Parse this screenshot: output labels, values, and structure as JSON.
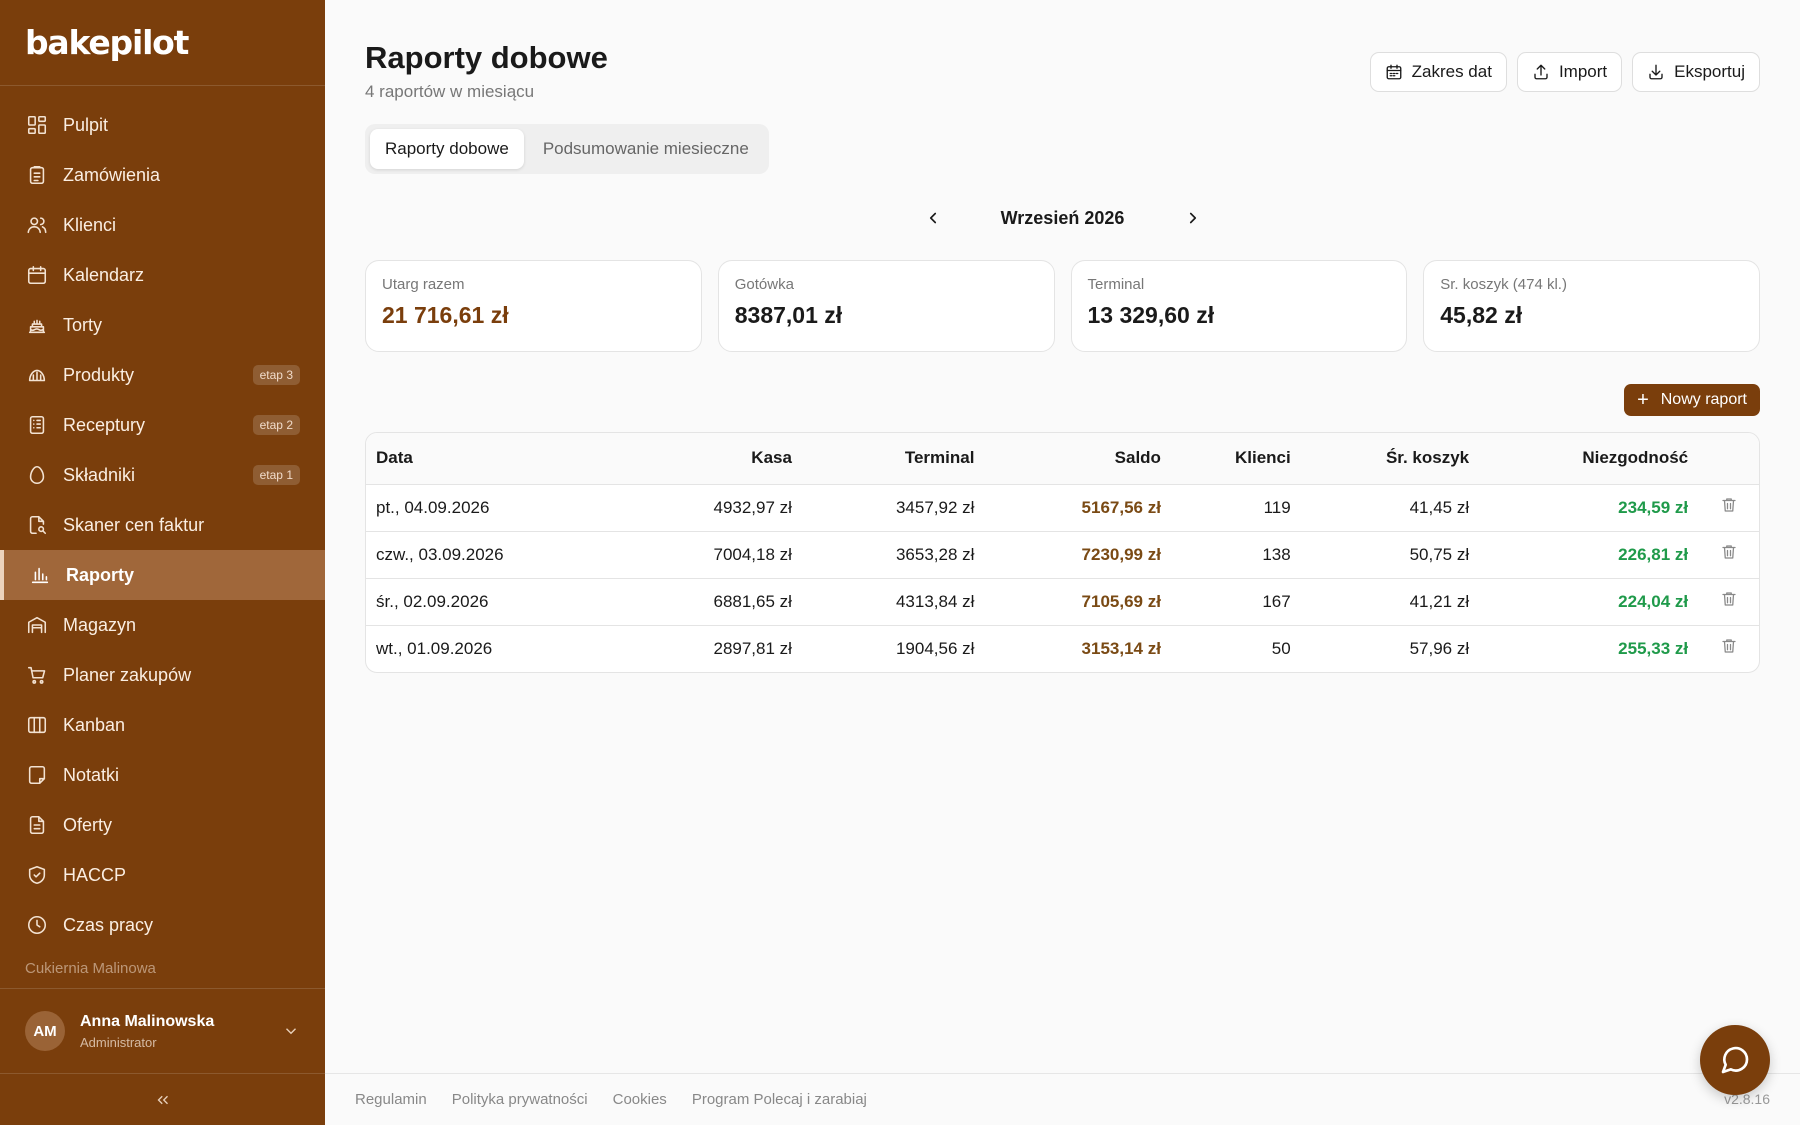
{
  "app": {
    "logo": "bakepilot"
  },
  "sidebar": {
    "items": [
      {
        "label": "Pulpit",
        "icon": "dashboard-icon",
        "badge": null,
        "active": false
      },
      {
        "label": "Zamówienia",
        "icon": "clipboard-icon",
        "badge": null,
        "active": false
      },
      {
        "label": "Klienci",
        "icon": "users-icon",
        "badge": null,
        "active": false
      },
      {
        "label": "Kalendarz",
        "icon": "calendar-icon",
        "badge": null,
        "active": false
      },
      {
        "label": "Torty",
        "icon": "cake-icon",
        "badge": null,
        "active": false
      },
      {
        "label": "Produkty",
        "icon": "croissant-icon",
        "badge": "etap 3",
        "active": false
      },
      {
        "label": "Receptury",
        "icon": "recipe-icon",
        "badge": "etap 2",
        "active": false
      },
      {
        "label": "Składniki",
        "icon": "egg-icon",
        "badge": "etap 1",
        "active": false
      },
      {
        "label": "Skaner cen faktur",
        "icon": "file-scan-icon",
        "badge": null,
        "active": false
      },
      {
        "label": "Raporty",
        "icon": "bar-chart-icon",
        "badge": null,
        "active": true
      },
      {
        "label": "Magazyn",
        "icon": "warehouse-icon",
        "badge": null,
        "active": false
      },
      {
        "label": "Planer zakupów",
        "icon": "cart-icon",
        "badge": null,
        "active": false
      },
      {
        "label": "Kanban",
        "icon": "kanban-icon",
        "badge": null,
        "active": false
      },
      {
        "label": "Notatki",
        "icon": "note-icon",
        "badge": null,
        "active": false
      },
      {
        "label": "Oferty",
        "icon": "document-icon",
        "badge": null,
        "active": false
      },
      {
        "label": "HACCP",
        "icon": "shield-check-icon",
        "badge": null,
        "active": false
      },
      {
        "label": "Czas pracy",
        "icon": "clock-icon",
        "badge": null,
        "active": false
      }
    ],
    "org_name": "Cukiernia Malinowa",
    "user": {
      "initials": "AM",
      "name": "Anna Malinowska",
      "role": "Administrator"
    }
  },
  "header": {
    "title": "Raporty dobowe",
    "subtitle": "4 raportów w miesiącu",
    "actions": {
      "date_range": "Zakres dat",
      "import": "Import",
      "export": "Eksportuj"
    }
  },
  "tabs": {
    "daily": "Raporty dobowe",
    "monthly": "Podsumowanie miesieczne"
  },
  "month_nav": {
    "label": "Wrzesień 2026"
  },
  "stats": [
    {
      "label": "Utarg razem",
      "value": "21 716,61 zł"
    },
    {
      "label": "Gotówka",
      "value": "8387,01 zł"
    },
    {
      "label": "Terminal",
      "value": "13 329,60 zł"
    },
    {
      "label": "Sr. koszyk (474 kl.)",
      "value": "45,82 zł"
    }
  ],
  "new_report_label": "Nowy raport",
  "table": {
    "columns": [
      "Data",
      "Kasa",
      "Terminal",
      "Saldo",
      "Klienci",
      "Śr. koszyk",
      "Niezgodność"
    ],
    "rows": [
      {
        "date": "pt., 04.09.2026",
        "kasa": "4932,97 zł",
        "terminal": "3457,92 zł",
        "saldo": "5167,56 zł",
        "klienci": "119",
        "koszyk": "41,45 zł",
        "niezgodnosc": "234,59 zł"
      },
      {
        "date": "czw., 03.09.2026",
        "kasa": "7004,18 zł",
        "terminal": "3653,28 zł",
        "saldo": "7230,99 zł",
        "klienci": "138",
        "koszyk": "50,75 zł",
        "niezgodnosc": "226,81 zł"
      },
      {
        "date": "śr., 02.09.2026",
        "kasa": "6881,65 zł",
        "terminal": "4313,84 zł",
        "saldo": "7105,69 zł",
        "klienci": "167",
        "koszyk": "41,21 zł",
        "niezgodnosc": "224,04 zł"
      },
      {
        "date": "wt., 01.09.2026",
        "kasa": "2897,81 zł",
        "terminal": "1904,56 zł",
        "saldo": "3153,14 zł",
        "klienci": "50",
        "koszyk": "57,96 zł",
        "niezgodnosc": "255,33 zł"
      }
    ]
  },
  "footer": {
    "links": [
      "Regulamin",
      "Polityka prywatności",
      "Cookies",
      "Program Polecaj i zarabiaj"
    ],
    "version": "v2.8.16"
  },
  "colors": {
    "sidebar_bg": "#7a3e0c",
    "accent": "#7a3e0c",
    "positive": "#1f9a4a",
    "saldo": "#7a4a14"
  }
}
